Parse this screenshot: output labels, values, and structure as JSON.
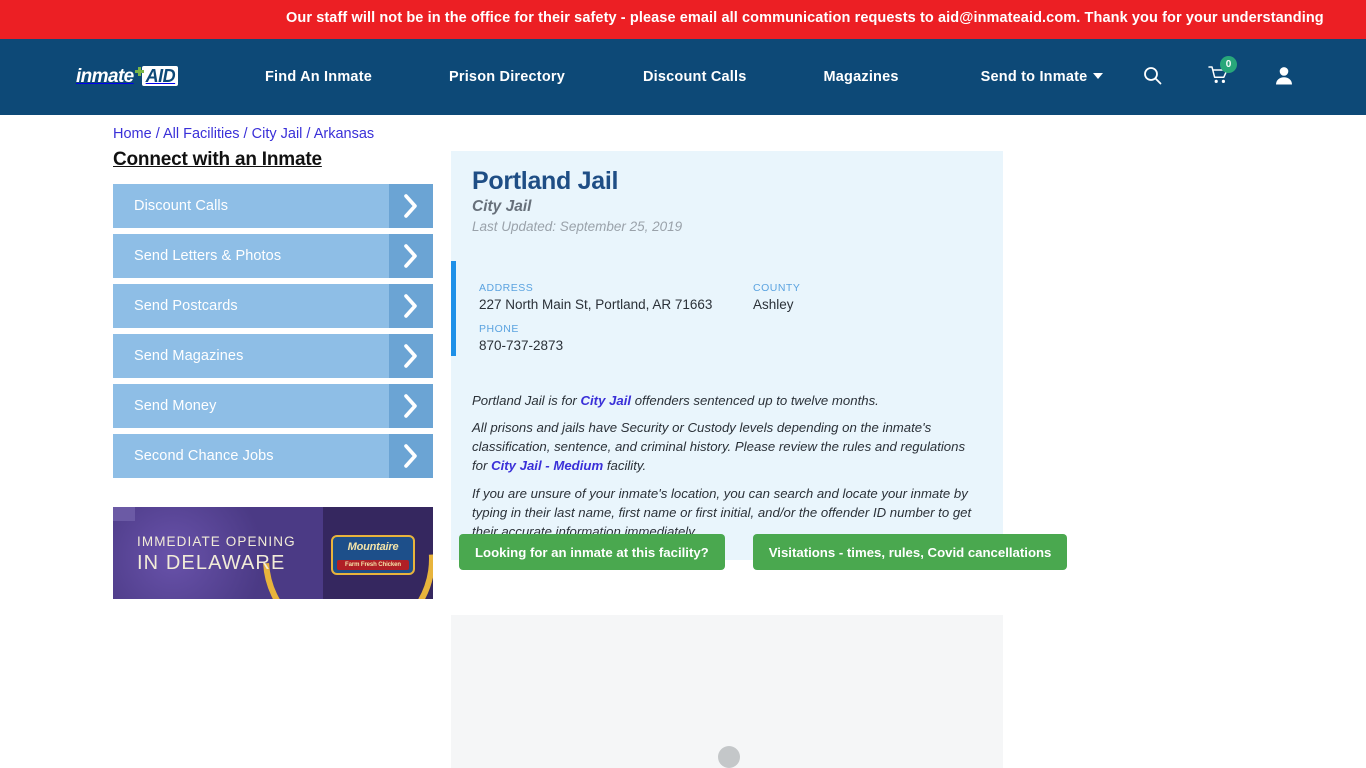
{
  "alert": {
    "text": "Our staff will not be in the office for their safety - please email all communication requests to aid@inmateaid.com. Thank you for your understanding",
    "background": "#ec1f24"
  },
  "navbar": {
    "background": "#0d4977",
    "logo": {
      "word1": "inmate",
      "plus_icon": "plus-icon",
      "word2": "AID"
    },
    "links": [
      {
        "label": "Find An Inmate"
      },
      {
        "label": "Prison Directory"
      },
      {
        "label": "Discount Calls"
      },
      {
        "label": "Magazines"
      },
      {
        "label": "Send to Inmate"
      }
    ],
    "icons": {
      "search": "search-icon",
      "cart": "cart-icon",
      "cart_count": "0",
      "cart_badge_color": "#28a77a",
      "account": "user-icon"
    }
  },
  "breadcrumb": {
    "link_color": "#3a30d8",
    "items": [
      {
        "label": "Home"
      },
      {
        "label": "All Facilities"
      },
      {
        "label": "City Jail"
      },
      {
        "label": "Arkansas"
      }
    ],
    "separator": "/"
  },
  "sidebar": {
    "title": "Connect with an Inmate",
    "button_color": "#8ebee6",
    "arrow_color": "#6ba4d4",
    "items": [
      {
        "label": "Discount Calls"
      },
      {
        "label": "Send Letters & Photos"
      },
      {
        "label": "Send Postcards"
      },
      {
        "label": "Send Magazines"
      },
      {
        "label": "Send Money"
      },
      {
        "label": "Second Chance Jobs"
      }
    ]
  },
  "ad": {
    "line1": "IMMEDIATE OPENING",
    "line2": "IN DELAWARE",
    "brand": "Mountaire",
    "brand_tagline": "Farm Fresh Chicken",
    "background": "#4b3a85",
    "accent": "#e8b43c"
  },
  "facility": {
    "name": "Portland Jail",
    "type": "City Jail",
    "last_updated": "Last Updated: September 25, 2019",
    "panel_background": "#e9f5fc",
    "accent_bar_color": "#1e90e8",
    "info": [
      {
        "label": "ADDRESS",
        "value": "227 North Main St, Portland, AR 71663"
      },
      {
        "label": "COUNTY",
        "value": "Ashley"
      },
      {
        "label": "PHONE",
        "value": "870-737-2873"
      }
    ],
    "paragraphs": {
      "p1_a": "Portland Jail is for ",
      "p1_link": "City Jail",
      "p1_b": " offenders sentenced up to twelve months.",
      "p2_a": "All prisons and jails have Security or Custody levels depending on the inmate's classification, sentence, and criminal history. Please review the rules and regulations for ",
      "p2_link": "City Jail - Medium",
      "p2_b": " facility.",
      "p3": "If you are unsure of your inmate's location, you can search and locate your inmate by typing in their last name, first name or first initial, and/or the offender ID number to get their accurate information immediately"
    }
  },
  "cta": {
    "color": "#4aa84f",
    "primary": "Looking for an inmate at this facility?",
    "secondary": "Visitations - times, rules, Covid cancellations"
  },
  "loading": {
    "background": "#f5f6f7",
    "dot_color": "#c4c7c9"
  }
}
